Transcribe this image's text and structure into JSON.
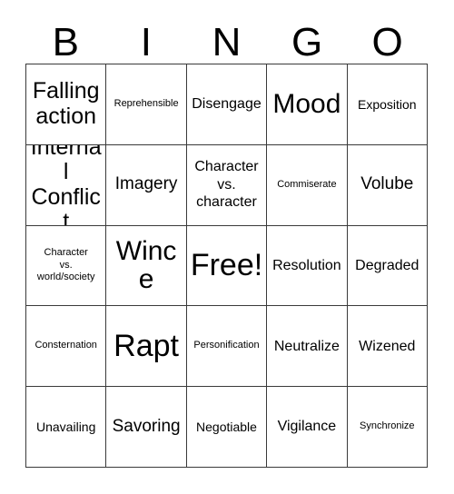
{
  "card": {
    "header_letters": [
      "B",
      "I",
      "N",
      "G",
      "O"
    ],
    "grid_size": "5x5",
    "colors": {
      "background": "#ffffff",
      "text": "#000000",
      "border": "#3a3a3a"
    },
    "rows": [
      [
        {
          "label": "Falling\naction",
          "size": "xl"
        },
        {
          "label": "Reprehensible",
          "size": "xs"
        },
        {
          "label": "Disengage",
          "size": "m"
        },
        {
          "label": "Mood",
          "size": "xxl"
        },
        {
          "label": "Exposition",
          "size": "s"
        }
      ],
      [
        {
          "label": "Internal\nConflict",
          "size": "xl"
        },
        {
          "label": "Imagery",
          "size": "l"
        },
        {
          "label": "Character\nvs.\ncharacter",
          "size": "m"
        },
        {
          "label": "Commiserate",
          "size": "xs"
        },
        {
          "label": "Volube",
          "size": "l"
        }
      ],
      [
        {
          "label": "Character\nvs.\nworld/society",
          "size": "xs"
        },
        {
          "label": "Wince",
          "size": "xxl"
        },
        {
          "label": "Free!",
          "size": "xxxl"
        },
        {
          "label": "Resolution",
          "size": "m"
        },
        {
          "label": "Degraded",
          "size": "m"
        }
      ],
      [
        {
          "label": "Consternation",
          "size": "xs"
        },
        {
          "label": "Rapt",
          "size": "xxxl"
        },
        {
          "label": "Personification",
          "size": "xs"
        },
        {
          "label": "Neutralize",
          "size": "m"
        },
        {
          "label": "Wizened",
          "size": "m"
        }
      ],
      [
        {
          "label": "Unavailing",
          "size": "s"
        },
        {
          "label": "Savoring",
          "size": "l"
        },
        {
          "label": "Negotiable",
          "size": "s"
        },
        {
          "label": "Vigilance",
          "size": "m"
        },
        {
          "label": "Synchronize",
          "size": "xs"
        }
      ]
    ]
  }
}
